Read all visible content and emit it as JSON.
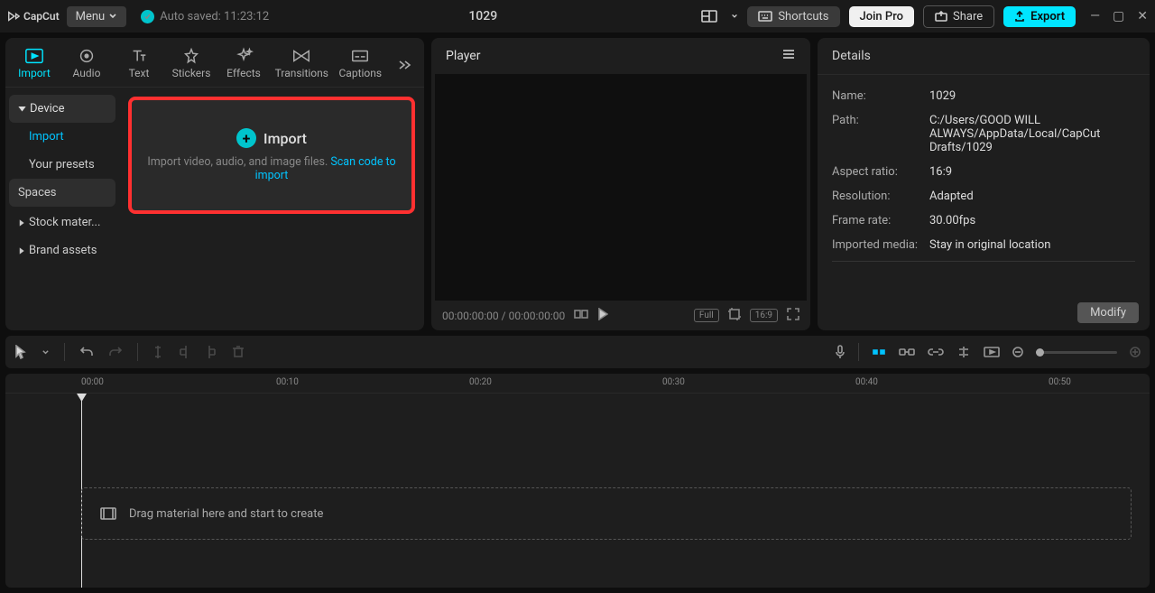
{
  "app": {
    "name": "CapCut"
  },
  "topbar": {
    "menu_label": "Menu",
    "autosave": "Auto saved: 11:23:12",
    "project_title": "1029",
    "shortcuts": "Shortcuts",
    "join_pro": "Join Pro",
    "share": "Share",
    "export": "Export"
  },
  "media_tabs": [
    {
      "id": "import",
      "label": "Import"
    },
    {
      "id": "audio",
      "label": "Audio"
    },
    {
      "id": "text",
      "label": "Text"
    },
    {
      "id": "stickers",
      "label": "Stickers"
    },
    {
      "id": "effects",
      "label": "Effects"
    },
    {
      "id": "transitions",
      "label": "Transitions"
    },
    {
      "id": "captions",
      "label": "Captions"
    }
  ],
  "sidebar": {
    "device": "Device",
    "import": "Import",
    "presets": "Your presets",
    "spaces": "Spaces",
    "stock": "Stock mater...",
    "brand": "Brand assets"
  },
  "import_zone": {
    "title": "Import",
    "subtitle_prefix": "Import video, audio, and image files. ",
    "link": "Scan code to import"
  },
  "player": {
    "title": "Player",
    "timecode": "00:00:00:00 / 00:00:00:00",
    "full": "Full",
    "ratio": "16:9"
  },
  "details": {
    "title": "Details",
    "rows": [
      {
        "label": "Name:",
        "value": "1029"
      },
      {
        "label": "Path:",
        "value": "C:/Users/GOOD WILL ALWAYS/AppData/Local/CapCut Drafts/1029"
      },
      {
        "label": "Aspect ratio:",
        "value": "16:9"
      },
      {
        "label": "Resolution:",
        "value": "Adapted"
      },
      {
        "label": "Frame rate:",
        "value": "30.00fps"
      },
      {
        "label": "Imported media:",
        "value": "Stay in original location"
      }
    ],
    "modify": "Modify"
  },
  "timeline": {
    "marks": [
      "00:00",
      "00:10",
      "00:20",
      "00:30",
      "00:40",
      "00:50"
    ],
    "drop_hint": "Drag material here and start to create"
  }
}
